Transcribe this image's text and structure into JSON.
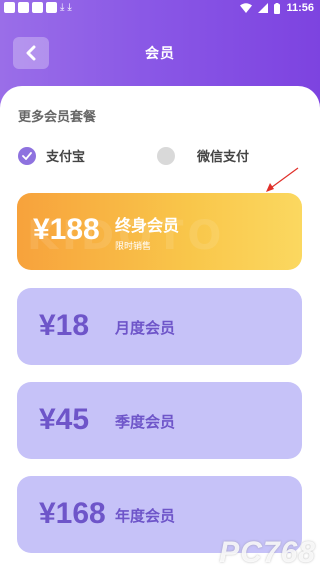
{
  "statusbar": {
    "time": "11:56",
    "download_glyph": "⤓"
  },
  "header": {
    "title": "会员"
  },
  "section": {
    "title": "更多会员套餐"
  },
  "payment": {
    "options": [
      {
        "label": "支付宝",
        "selected": true
      },
      {
        "label": "微信支付",
        "selected": false
      }
    ]
  },
  "plans": [
    {
      "price": "¥188",
      "name": "终身会员",
      "sub": "限时销售",
      "featured": true,
      "watermark": "KIDOTO"
    },
    {
      "price": "¥18",
      "name": "月度会员"
    },
    {
      "price": "¥45",
      "name": "季度会员"
    },
    {
      "price": "¥168",
      "name": "年度会员"
    }
  ],
  "watermark": {
    "brand": "PC768",
    "sub": "网"
  },
  "colors": {
    "header_start": "#9a6ee8",
    "header_end": "#7d43e0",
    "featured_start": "#f7a23c",
    "featured_end": "#fbd860",
    "plan_bg": "#c6c2f8",
    "plan_text": "#6e55c9",
    "radio_on": "#8e72df",
    "annotation_arrow": "#e0302a"
  }
}
